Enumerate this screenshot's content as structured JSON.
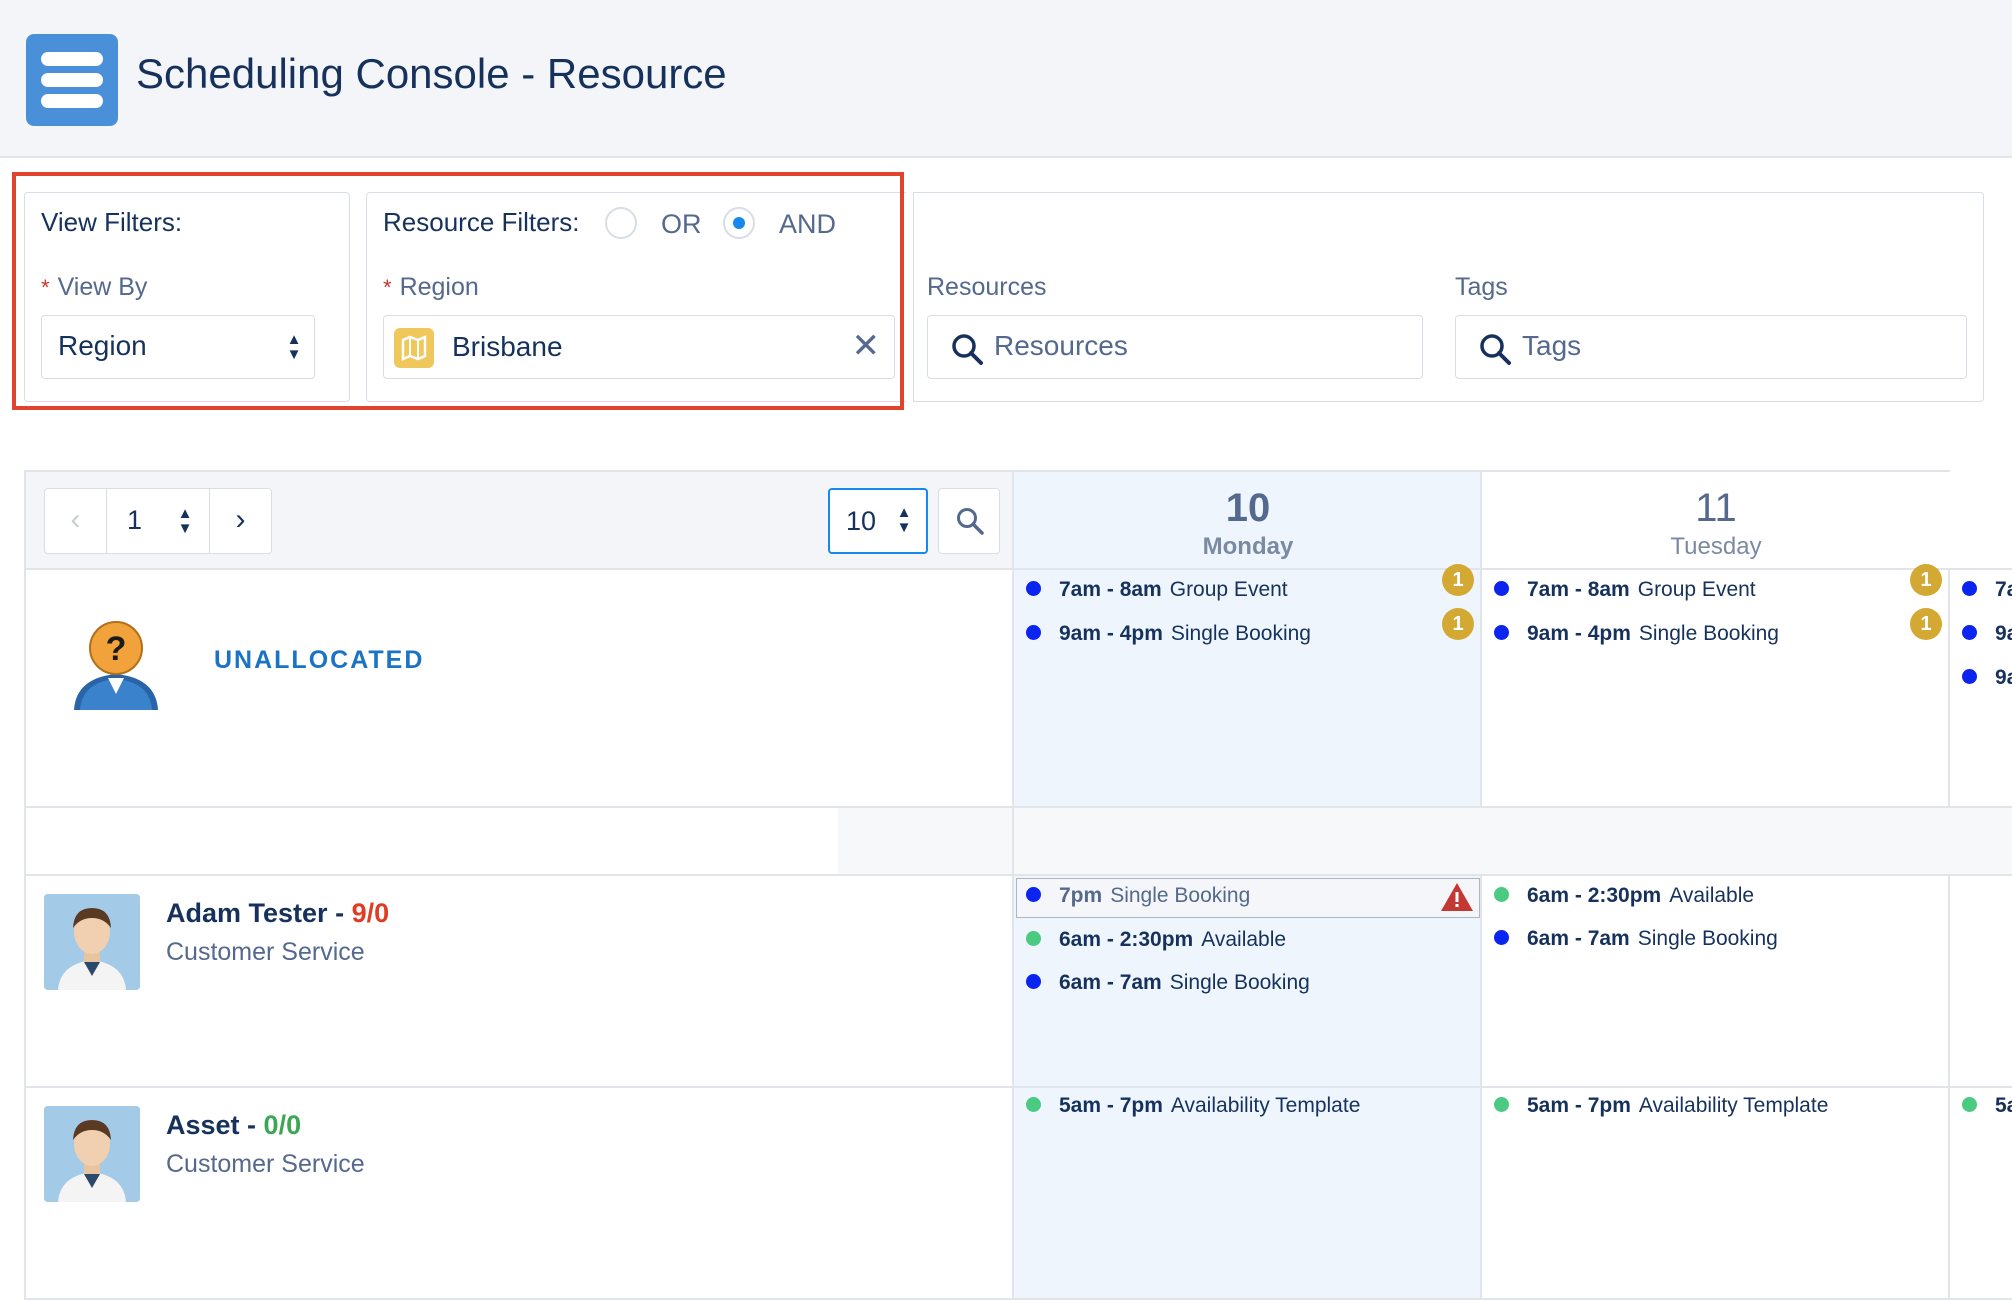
{
  "header": {
    "title": "Scheduling Console - Resource"
  },
  "view_filters": {
    "title": "View Filters:",
    "view_by_label": "View By",
    "view_by_value": "Region"
  },
  "resource_filters": {
    "title": "Resource Filters:",
    "or_label": "OR",
    "and_label": "AND",
    "selected_mode": "AND",
    "region_label": "Region",
    "region_value": "Brisbane",
    "resources_label": "Resources",
    "resources_placeholder": "Resources",
    "tags_label": "Tags",
    "tags_placeholder": "Tags"
  },
  "pager": {
    "page": "1",
    "page_size": "10"
  },
  "days": [
    {
      "num": "10",
      "name": "Monday"
    },
    {
      "num": "11",
      "name": "Tuesday"
    }
  ],
  "unallocated": {
    "label": "UNALLOCATED",
    "monday": [
      {
        "time": "7am - 8am",
        "title": "Group Event",
        "badge": "1",
        "color": "#0b24f0"
      },
      {
        "time": "9am - 4pm",
        "title": "Single Booking",
        "badge": "1",
        "color": "#0b24f0"
      }
    ],
    "tuesday": [
      {
        "time": "7am - 8am",
        "title": "Group Event",
        "badge": "1",
        "color": "#0b24f0"
      },
      {
        "time": "9am - 4pm",
        "title": "Single Booking",
        "badge": "1",
        "color": "#0b24f0"
      }
    ],
    "wednesday_partial": [
      "7a",
      "9a",
      "9a"
    ]
  },
  "resources": [
    {
      "name": "Adam Tester",
      "count": "9/0",
      "count_color": "#e03b24",
      "role": "Customer Service",
      "monday": [
        {
          "time": "7pm",
          "title": "Single Booking",
          "color": "#0b24f0",
          "warning": true
        },
        {
          "time": "6am - 2:30pm",
          "title": "Available",
          "color": "#4bca81"
        },
        {
          "time": "6am - 7am",
          "title": "Single Booking",
          "color": "#0b24f0"
        }
      ],
      "tuesday": [
        {
          "time": "6am - 2:30pm",
          "title": "Available",
          "color": "#4bca81"
        },
        {
          "time": "6am - 7am",
          "title": "Single Booking",
          "color": "#0b24f0"
        }
      ]
    },
    {
      "name": "Asset",
      "count": "0/0",
      "count_color": "#3ba755",
      "role": "Customer Service",
      "monday": [
        {
          "time": "5am - 7pm",
          "title": "Availability Template",
          "color": "#4bca81"
        }
      ],
      "tuesday": [
        {
          "time": "5am - 7pm",
          "title": "Availability Template",
          "color": "#4bca81"
        }
      ],
      "wednesday_partial": "5a"
    }
  ],
  "colors": {
    "accent": "#1589ee",
    "highlight_border": "#e0432e",
    "today_column": "#eef5fd"
  }
}
